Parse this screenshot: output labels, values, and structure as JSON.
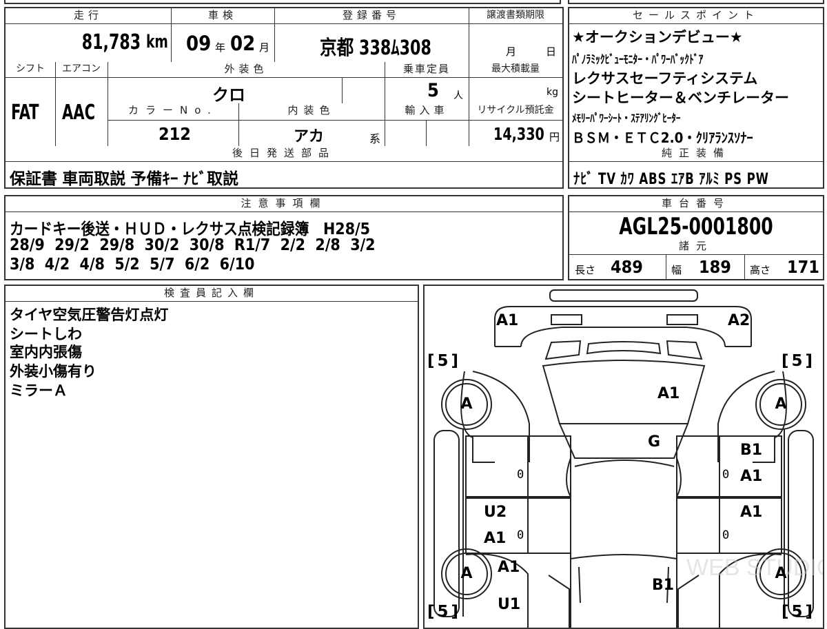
{
  "top_cut": {
    "a": "",
    "b": "",
    "c": ""
  },
  "mileage": {
    "header": "走行",
    "value": "81,783",
    "unit": "km"
  },
  "shaken": {
    "header": "車検",
    "year": "09",
    "year_unit": "年",
    "month": "02",
    "month_unit": "月"
  },
  "registration": {
    "header": "登録番号",
    "value": "京都 338ﾑ308"
  },
  "transfer_deadline": {
    "header": "譲渡書類期限",
    "month_unit": "月",
    "day_unit": "日"
  },
  "shift": {
    "header": "シフト",
    "value": "FAT"
  },
  "aircon": {
    "header": "エアコン",
    "value": "AAC"
  },
  "exterior_color": {
    "header": "外装色",
    "value": "クロ"
  },
  "capacity": {
    "header": "乗車定員",
    "value": "5",
    "unit": "人"
  },
  "max_load": {
    "header": "最大積載量",
    "unit": "kg"
  },
  "color_no": {
    "header": "カラーNo.",
    "value": "212"
  },
  "interior_color": {
    "header": "内装色",
    "value": "アカ",
    "suffix": "系"
  },
  "import": {
    "header": "輸入車"
  },
  "recycle": {
    "header": "リサイクル預託金",
    "value": "14,330",
    "unit": "円"
  },
  "later_parts": {
    "header": "後日発送部品",
    "value": "保証書 車両取説 予備ｷｰ ﾅﾋﾞ取説"
  },
  "sales_points": {
    "header": "セールスポイント",
    "lines": [
      "★オークションデビュー★",
      "ﾊﾟﾉﾗﾐｯｸﾋﾞｭｰﾓﾆﾀｰ・ﾊﾟﾜｰﾊﾞｯｸﾄﾞｱ",
      "レクサスセーフティシステム",
      "シートヒーター＆ベンチレーター",
      "ﾒﾓﾘｰﾊﾟﾜｰｼｰﾄ・ｽﾃｱﾘﾝｸﾞﾋｰﾀｰ",
      "ＢＳＭ・ＥＴＣ2.0・ｸﾘｱﾗﾝｽｿﾅｰ"
    ]
  },
  "genuine_equipment": {
    "header": "純正装備",
    "value": "ﾅﾋﾞ TV ｶﾜ ABS ｴｱB ｱﾙﾐ PS PW"
  },
  "notes": {
    "header": "注意事項欄",
    "lines": [
      "カードキー後送・ＨＵＤ・レクサス点検記録簿　H28/5",
      "28/9  29/2  29/8  30/2  30/8  R1/7  2/2  2/8  3/2",
      "3/8  4/2  4/8  5/2  5/7  6/2  6/10"
    ]
  },
  "chassis": {
    "header": "車台番号",
    "value": "AGL25-0001800"
  },
  "specs": {
    "header": "諸元",
    "length_label": "長さ",
    "length": "489",
    "width_label": "幅",
    "width": "189",
    "height_label": "高さ",
    "height": "171"
  },
  "inspector": {
    "header": "検査員記入欄",
    "lines": [
      "タイヤ空気圧警告灯点灯",
      "シートしわ",
      "室内内張傷",
      "外装小傷有り",
      "ミラーＡ"
    ]
  },
  "diagram": {
    "labels": {
      "roof_front_left": "A1",
      "roof_front_right": "A2",
      "windshield": "A1",
      "hood": "G",
      "right_front_1": "B1",
      "right_front_2": "A1",
      "right_rear": "A1",
      "left_rear_1": "U2",
      "left_rear_2": "A1",
      "left_rear_3": "A1",
      "rear_bottom_left": "U1",
      "rear_center": "B1",
      "zero": "0"
    },
    "wheel": "A",
    "tire": "5",
    "watermark": "WEB STUDIO PC"
  }
}
